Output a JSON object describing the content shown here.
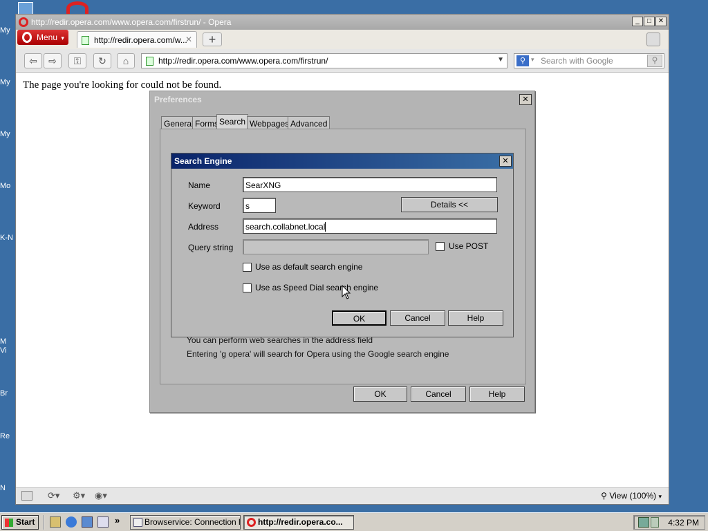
{
  "desktop": {
    "icon_labels": [
      "My",
      "My",
      "My",
      "Mo",
      "K-N",
      "M",
      "Vi",
      "Br",
      "Re",
      "N"
    ]
  },
  "browser": {
    "window_title": "http://redir.opera.com/www.opera.com/firstrun/ - Opera",
    "menu_label": "Menu",
    "tab_title": "http://redir.opera.com/w...",
    "address": "http://redir.opera.com/www.opera.com/firstrun/",
    "search_placeholder": "Search with Google",
    "page_message": "The page you're looking for could not be found.",
    "zoom_label": "View (100%)"
  },
  "preferences": {
    "title": "Preferences",
    "tabs": [
      "General",
      "Forms",
      "Search",
      "Webpages",
      "Advanced"
    ],
    "active_tab": "Search",
    "info_line_1": "You can perform web searches in the address field",
    "info_line_2": "Entering 'g opera' will search for Opera using the Google search engine",
    "ok_label": "OK",
    "cancel_label": "Cancel",
    "help_label": "Help"
  },
  "search_engine": {
    "title": "Search Engine",
    "name_label": "Name",
    "name_value": "SearXNG",
    "keyword_label": "Keyword",
    "keyword_value": "s",
    "details_label": "Details <<",
    "address_label": "Address",
    "address_value": "search.collabnet.local",
    "query_label": "Query string",
    "query_value": "",
    "use_post_label": "Use POST",
    "use_post_checked": false,
    "default_label": "Use as default search engine",
    "default_checked": false,
    "speed_dial_label": "Use as Speed Dial search engine",
    "speed_dial_checked": false,
    "ok_label": "OK",
    "cancel_label": "Cancel",
    "help_label": "Help"
  },
  "taskbar": {
    "start_label": "Start",
    "tasks": [
      "Browservice: Connection l...",
      "http://redir.opera.co..."
    ],
    "clock": "4:32 PM",
    "overflow": "»"
  },
  "colors": {
    "desktop": "#3a6ea5",
    "opera_red": "#cc1111",
    "dialog_title": "#0a246a"
  }
}
